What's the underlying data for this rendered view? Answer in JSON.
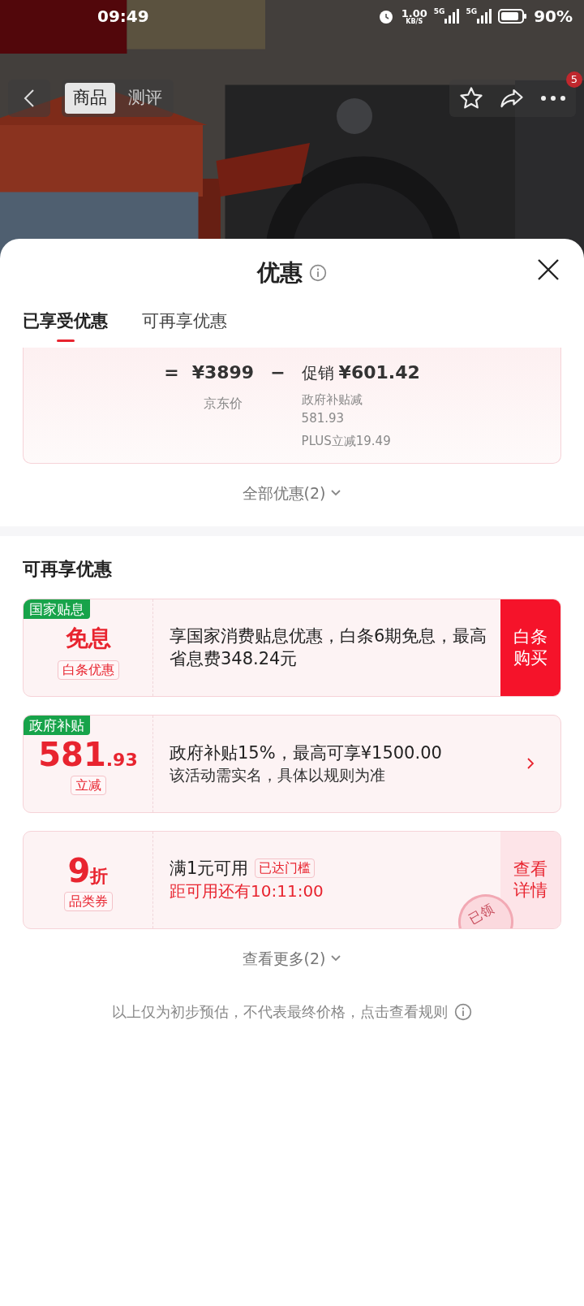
{
  "status_bar": {
    "time": "09:49",
    "speed": "1.00",
    "speed_unit": "KB/S",
    "sim1": "5G",
    "sim2": "5G",
    "battery": "90%"
  },
  "nav": {
    "tabs": [
      {
        "label": "商品",
        "selected": true
      },
      {
        "label": "测评",
        "selected": false
      }
    ],
    "more_badge": "5"
  },
  "sheet": {
    "title": "优惠",
    "tabs": [
      {
        "label": "已享受优惠",
        "selected": true
      },
      {
        "label": "可再享优惠",
        "selected": false
      }
    ],
    "price_breakdown": {
      "equals": "=",
      "price": "¥3899",
      "price_label": "京东价",
      "minus": "−",
      "promo_label": "促销",
      "promo_amount": "¥601.42",
      "details": [
        "政府补贴减\n581.93",
        "PLUS立减19.49"
      ]
    },
    "expand_all": "全部优惠(2)",
    "more_section": {
      "title": "可再享优惠",
      "coupons": [
        {
          "kind": "text",
          "tag": "国家贴息",
          "main": "免息",
          "sub": "白条优惠",
          "line1": "享国家消费贴息优惠，白条6期免息，最高省息费348.24元",
          "action": {
            "kind": "solid",
            "label": "白条购买"
          }
        },
        {
          "kind": "amount",
          "tag": "政府补贴",
          "main": "581",
          "main_small": ".93",
          "sub": "立减",
          "line1": "政府补贴15%，最高可享¥1500.00",
          "line2": "该活动需实名，具体以规则为准",
          "action": {
            "kind": "chevron"
          }
        },
        {
          "kind": "discount",
          "main": "9",
          "main_small": "折",
          "sub": "品类券",
          "line1": "满1元可用",
          "badge": "已达门槛",
          "line2": "距可用还有10:11:00",
          "action": {
            "kind": "soft",
            "label": "查看详情"
          },
          "stamp": "已领"
        }
      ],
      "see_more": "查看更多(2)"
    },
    "footer": "以上仅为初步预估，不代表最终价格，点击查看规则"
  }
}
